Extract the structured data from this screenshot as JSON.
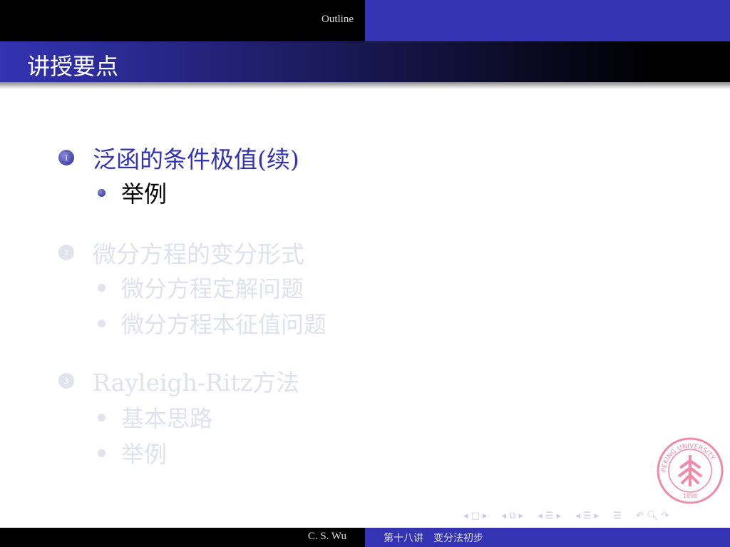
{
  "header": {
    "section": "Outline"
  },
  "frame_title": "讲授要点",
  "sections": [
    {
      "number": "1",
      "title": "泛函的条件极值(续)",
      "items": [
        "举例"
      ]
    },
    {
      "number": "2",
      "title": "微分方程的变分形式",
      "items": [
        "微分方程定解问题",
        "微分方程本征值问题"
      ]
    },
    {
      "number": "3",
      "title": "Rayleigh-Ritz方法",
      "items": [
        "基本思路",
        "举例"
      ]
    }
  ],
  "logo": {
    "text": "PEKING UNIVERSITY 1898"
  },
  "footer": {
    "author": "C. S. Wu",
    "title": "第十八讲　变分法初步"
  },
  "colors": {
    "accent": "#3333b3",
    "faded": "#e0e0ee",
    "seal": "#f08aa8"
  }
}
